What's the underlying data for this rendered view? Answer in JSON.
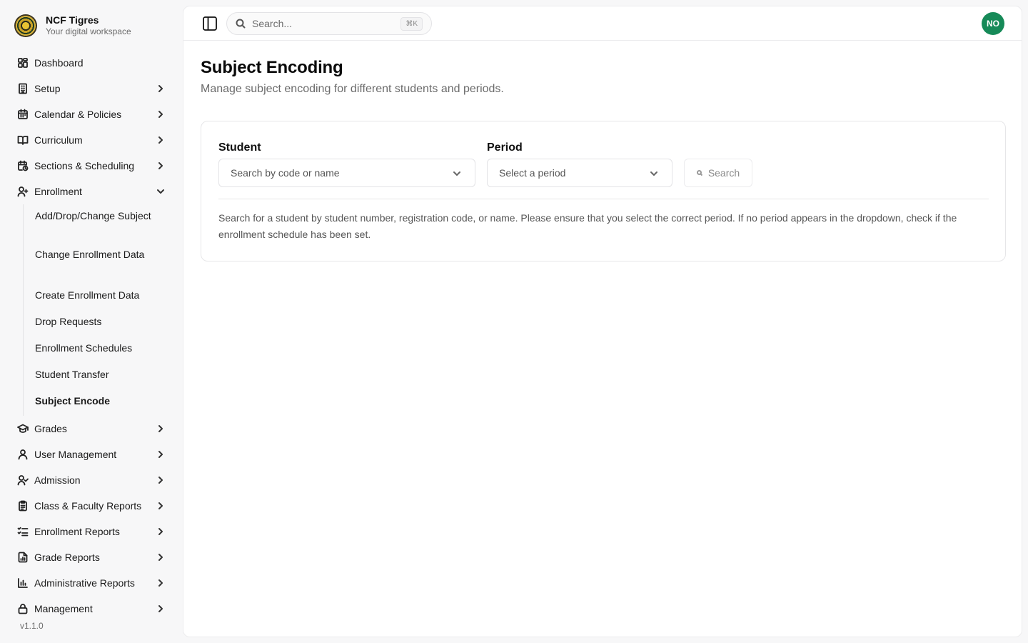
{
  "brand": {
    "name": "NCF Tigres",
    "tagline": "Your digital workspace"
  },
  "sidebar": {
    "items": [
      {
        "label": "Dashboard",
        "icon": "dashboard-icon",
        "chevron": "none"
      },
      {
        "label": "Setup",
        "icon": "building-icon",
        "chevron": "right"
      },
      {
        "label": "Calendar & Policies",
        "icon": "calendar-icon",
        "chevron": "right"
      },
      {
        "label": "Curriculum",
        "icon": "book-open-icon",
        "chevron": "right"
      },
      {
        "label": "Sections & Scheduling",
        "icon": "calendar-clock-icon",
        "chevron": "right"
      },
      {
        "label": "Enrollment",
        "icon": "user-plus-icon",
        "chevron": "down"
      }
    ],
    "enrollment_sub": [
      {
        "label": "Add/Drop/Change Subject"
      },
      {
        "label": "Change Enrollment Data"
      },
      {
        "label": "Create Enrollment Data"
      },
      {
        "label": "Drop Requests"
      },
      {
        "label": "Enrollment Schedules"
      },
      {
        "label": "Student Transfer"
      },
      {
        "label": "Subject Encode",
        "active": true
      }
    ],
    "items_after": [
      {
        "label": "Grades",
        "icon": "graduation-cap-icon",
        "chevron": "right"
      },
      {
        "label": "User Management",
        "icon": "user-icon",
        "chevron": "right"
      },
      {
        "label": "Admission",
        "icon": "user-check-icon",
        "chevron": "right"
      },
      {
        "label": "Class & Faculty Reports",
        "icon": "clipboard-icon",
        "chevron": "right"
      },
      {
        "label": "Enrollment Reports",
        "icon": "list-checks-icon",
        "chevron": "right"
      },
      {
        "label": "Grade Reports",
        "icon": "file-chart-icon",
        "chevron": "right"
      },
      {
        "label": "Administrative Reports",
        "icon": "bar-chart-icon",
        "chevron": "right"
      },
      {
        "label": "Management",
        "icon": "lock-icon",
        "chevron": "right"
      }
    ],
    "version": "v1.1.0"
  },
  "topbar": {
    "search_placeholder": "Search...",
    "shortcut": "⌘K",
    "avatar_initials": "NO",
    "avatar_color": "#168a58"
  },
  "page": {
    "title": "Subject Encoding",
    "subtitle": "Manage subject encoding for different students and periods."
  },
  "form": {
    "student_label": "Student",
    "student_placeholder": "Search by code or name",
    "period_label": "Period",
    "period_placeholder": "Select a period",
    "search_button": "Search",
    "help_text": "Search for a student by student number, registration code, or name. Please ensure that you select the correct period. If no period appears in the dropdown, check if the enrollment schedule has been set."
  }
}
